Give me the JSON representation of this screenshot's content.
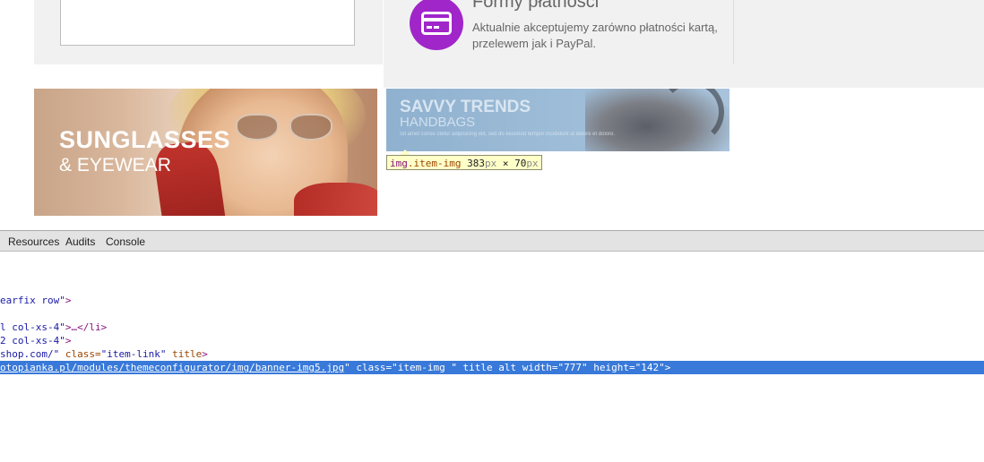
{
  "payment": {
    "title": "Formy płatności",
    "description": "Aktualnie akceptujemy zarówno płatności kartą, przelewem jak i PayPal.",
    "icon": "credit-card-icon",
    "icon_color": "#a026c9"
  },
  "banners": {
    "sunglasses": {
      "title": "SUNGLASSES",
      "subtitle": "& EYEWEAR"
    },
    "handbags": {
      "title": "SAVVY TRENDS",
      "subtitle": "HANDBAGS",
      "fineprint": "Sit amet conse ctetur adipisicing elit, sed do eiusmod tempor incididunt ut labore et dolore."
    }
  },
  "tooltip": {
    "tag": "img",
    "class": ".item-img",
    "width": "383",
    "height": "70",
    "unit": "px",
    "times": "×"
  },
  "devtools": {
    "tabs": [
      "Resources",
      "Audits",
      "Console"
    ],
    "lines": [
      {
        "parts": [
          [
            "earfix row\"",
            "val"
          ],
          [
            ">",
            "tag"
          ]
        ]
      },
      {
        "parts": [
          [
            "l col-xs-4\"",
            "val"
          ],
          [
            ">…</li>",
            "tag"
          ]
        ]
      },
      {
        "parts": [
          [
            "2 col-xs-4\"",
            "val"
          ],
          [
            ">",
            "tag"
          ]
        ]
      },
      {
        "parts": [
          [
            "shop.com/\"",
            "val"
          ],
          [
            " class=",
            "attr"
          ],
          [
            "\"item-link\"",
            "val"
          ],
          [
            " title",
            "attr"
          ],
          [
            ">",
            "tag"
          ]
        ]
      },
      {
        "parts": [
          [
            "otopianka.pl/modules/themeconfigurator/img/banner-img5.jpg",
            "link"
          ],
          [
            "\" class=\"item-img \" title alt width=\"777\" height=\"142\">",
            "plain"
          ]
        ]
      }
    ]
  }
}
